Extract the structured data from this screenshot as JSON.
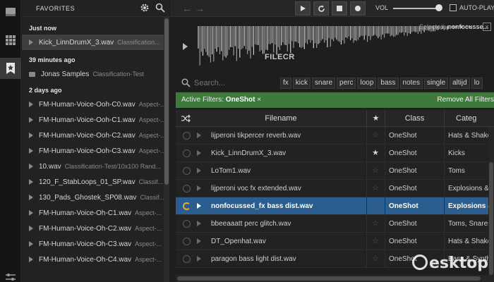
{
  "favorites_panel": {
    "title": "FAVORITES",
    "sections": [
      {
        "label": "Just now"
      },
      {
        "label": "39 minutes ago"
      },
      {
        "label": "2 days ago"
      }
    ],
    "items": [
      {
        "name": "Kick_LinnDrumX_3.wav",
        "sub": "Classification..."
      },
      {
        "name": "Jonas Samples",
        "sub": "Classification-Test"
      },
      {
        "name": "FM-Human-Voice-Ooh-C0.wav",
        "sub": "Aspect-..."
      },
      {
        "name": "FM-Human-Voice-Ooh-C1.wav",
        "sub": "Aspect-..."
      },
      {
        "name": "FM-Human-Voice-Ooh-C2.wav",
        "sub": "Aspect-..."
      },
      {
        "name": "FM-Human-Voice-Ooh-C3.wav",
        "sub": "Aspect-..."
      },
      {
        "name": "10.wav",
        "sub": "Classification-Test/10x100 Rand..."
      },
      {
        "name": "120_F_StabLoops_01_SP.wav",
        "sub": "Classif..."
      },
      {
        "name": "130_Pads_Ghostek_SP08.wav",
        "sub": "Classif..."
      },
      {
        "name": "FM-Human-Voice-Oh-C1.wav",
        "sub": "Aspect-..."
      },
      {
        "name": "FM-Human-Voice-Oh-C2.wav",
        "sub": "Aspect-..."
      },
      {
        "name": "FM-Human-Voice-Oh-C3.wav",
        "sub": "Aspect-..."
      },
      {
        "name": "FM-Human-Voice-Oh-C4.wav",
        "sub": "Aspect-..."
      }
    ]
  },
  "toolbar": {
    "volume_label": "VOL",
    "volume_level": 0.9,
    "autoplay_label": "AUTO-PLAY",
    "autoplay_checked": false
  },
  "waveform": {
    "selected_prefix": "Selected:",
    "selected_name": "nonfocusse..."
  },
  "watermark": {
    "filecr": "FILECR",
    "logo": "esktop"
  },
  "search": {
    "placeholder": "Search...",
    "tags": [
      "fx",
      "kick",
      "snare",
      "perc",
      "loop",
      "bass",
      "notes",
      "single",
      "altijd",
      "lo"
    ]
  },
  "filters": {
    "label": "Active Filters:",
    "value": "OneShot",
    "remove_label": "Remove All Filters"
  },
  "table": {
    "columns": {
      "filename": "Filename",
      "class": "Class",
      "category": "Categ"
    },
    "rows": [
      {
        "filename": "lijperoni tikpercer reverb.wav",
        "star": false,
        "class": "OneShot",
        "category": "Hats & Shaker"
      },
      {
        "filename": "Kick_LinnDrumX_3.wav",
        "star": true,
        "class": "OneShot",
        "category": "Kicks"
      },
      {
        "filename": "LoTom1.wav",
        "star": false,
        "class": "OneShot",
        "category": "Toms"
      },
      {
        "filename": "lijperoni voc fx extended.wav",
        "star": false,
        "class": "OneShot",
        "category": "Explosions & S"
      },
      {
        "filename": "nonfocussed_fx bass dist.wav",
        "star": false,
        "class": "OneShot",
        "category": "Explosions & S",
        "selected": true
      },
      {
        "filename": "bbeeaaatt perc glitch.wav",
        "star": false,
        "class": "OneShot",
        "category": "Toms, Snares"
      },
      {
        "filename": "DT_Openhat.wav",
        "star": false,
        "class": "OneShot",
        "category": "Hats & Shaker"
      },
      {
        "filename": "paragon bass light dist.wav",
        "star": false,
        "class": "OneShot",
        "category": "Bass & Synth"
      }
    ]
  },
  "colors": {
    "accent_green": "#3f7a3c",
    "selected_row": "#2c5d8f",
    "background": "#1e1e1e"
  }
}
